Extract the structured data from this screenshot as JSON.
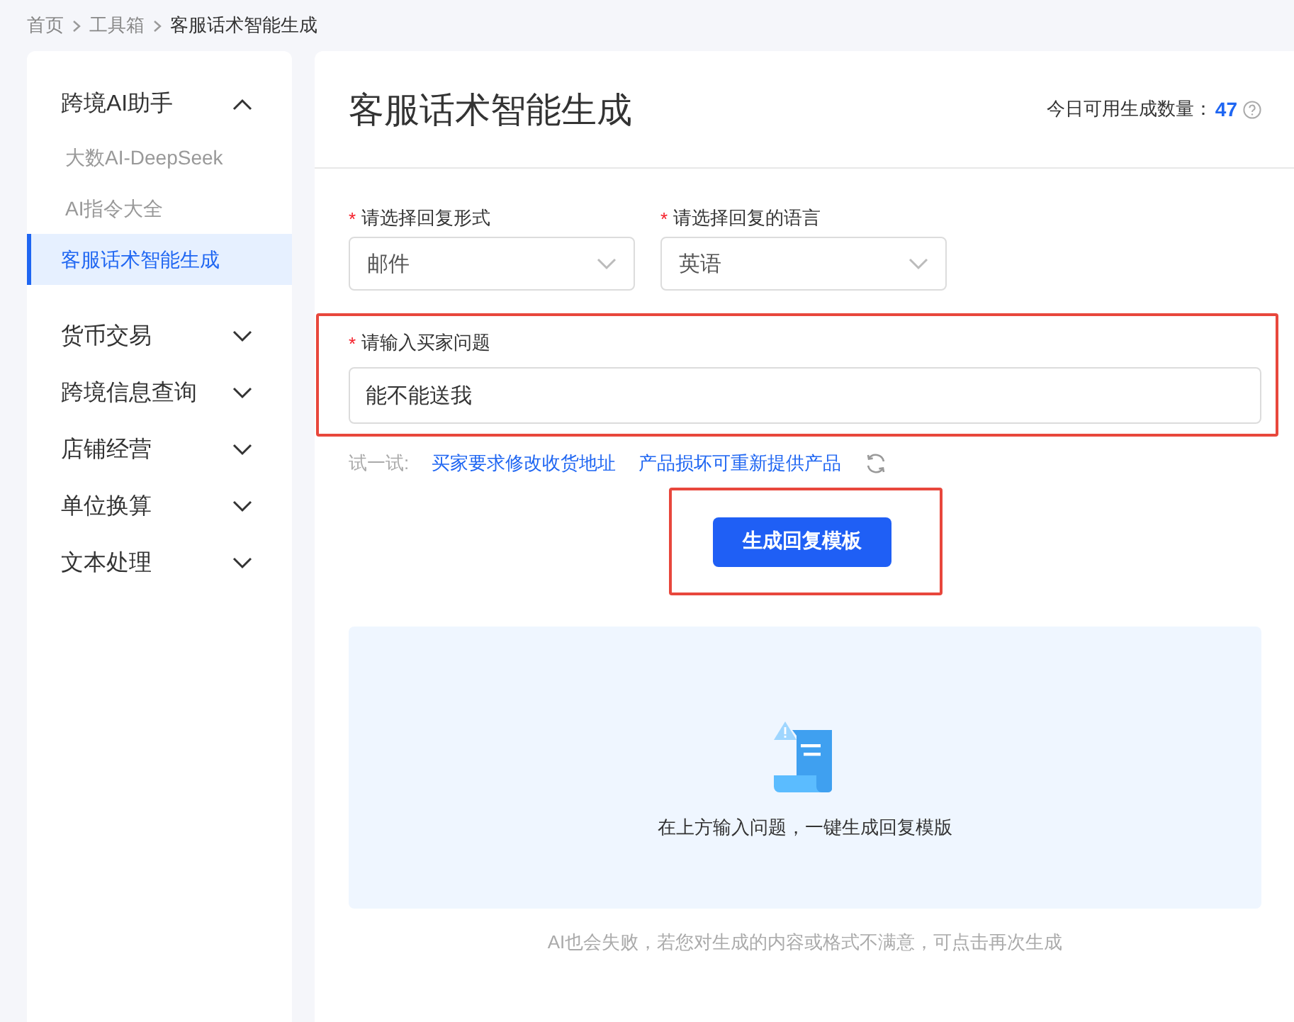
{
  "breadcrumb": [
    {
      "label": "首页",
      "current": false
    },
    {
      "label": "工具箱",
      "current": false
    },
    {
      "label": "客服话术智能生成",
      "current": true
    }
  ],
  "sidebar": {
    "groups": [
      {
        "label": "跨境AI助手",
        "expanded": true,
        "children": [
          {
            "label": "大数AI-DeepSeek",
            "selected": false
          },
          {
            "label": "AI指令大全",
            "selected": false
          },
          {
            "label": "客服话术智能生成",
            "selected": true
          }
        ]
      },
      {
        "label": "货币交易",
        "expanded": false
      },
      {
        "label": "跨境信息查询",
        "expanded": false
      },
      {
        "label": "店铺经营",
        "expanded": false
      },
      {
        "label": "单位换算",
        "expanded": false
      },
      {
        "label": "文本处理",
        "expanded": false
      }
    ]
  },
  "header": {
    "title": "客服话术智能生成",
    "quota_label": "今日可用生成数量：",
    "quota_value": "47"
  },
  "form": {
    "selects": [
      {
        "required_mark": "*",
        "label": "请选择回复形式",
        "value": "邮件"
      },
      {
        "required_mark": "*",
        "label": "请选择回复的语言",
        "value": "英语"
      }
    ],
    "question": {
      "required_mark": "*",
      "label": "请输入买家问题",
      "value": "能不能送我",
      "highlighted": true
    }
  },
  "suggestions": {
    "label": "试一试:",
    "items": [
      "买家要求修改收货地址",
      "产品损坏可重新提供产品"
    ]
  },
  "generate_button": {
    "label": "生成回复模板",
    "highlighted": true
  },
  "empty_state": {
    "message": "在上方输入问题，一键生成回复模版"
  },
  "footer_note": "AI也会失败，若您对生成的内容或格式不满意，可点击再次生成"
}
